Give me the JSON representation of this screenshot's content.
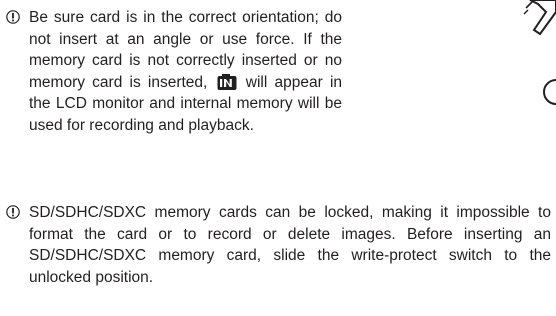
{
  "notes": [
    {
      "icon": "caution-icon",
      "text_before_icon": "Be sure card is in the correct orientation; do not insert at an angle or use force.  If the memory card is not correctly inserted or no memory card is inserted,",
      "inline_icon": "internal-memory-icon",
      "text_after_icon": "will appear in the LCD monitor and internal memory will be used for recording and playback."
    },
    {
      "icon": "caution-icon",
      "text": "SD/SDHC/SDXC memory cards can be locked, making it impossible to format the card or to record or delete images.  Before inserting an SD/SDHC/SDXC memory card, slide the write-protect switch to the unlocked position."
    }
  ],
  "illustration": {
    "icon": "camera-card-slot-illustration"
  }
}
